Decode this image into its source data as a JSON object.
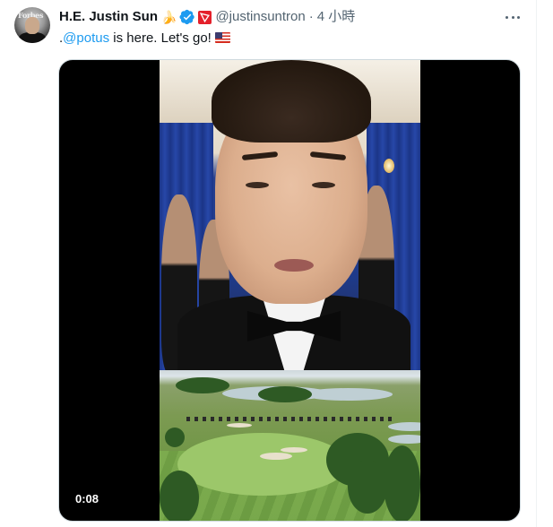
{
  "tweet": {
    "author_name": "H.E. Justin Sun",
    "name_emoji": "🍌",
    "handle": "@justinsuntron",
    "separator": "·",
    "timestamp": "4 小時",
    "text_prefix": ".",
    "mention": "@potus",
    "text_body": " is here. Let's go!",
    "text_flag_icon": "us-flag-icon",
    "more_icon": "more-dots-icon",
    "avatar_caption": "Forbes"
  },
  "media": {
    "type": "video",
    "duration_label": "0:08"
  },
  "colors": {
    "link": "#1d9bf0",
    "verified": "#1d9bf0",
    "secondary_text": "#536471",
    "tron_badge": "#e4202b"
  }
}
